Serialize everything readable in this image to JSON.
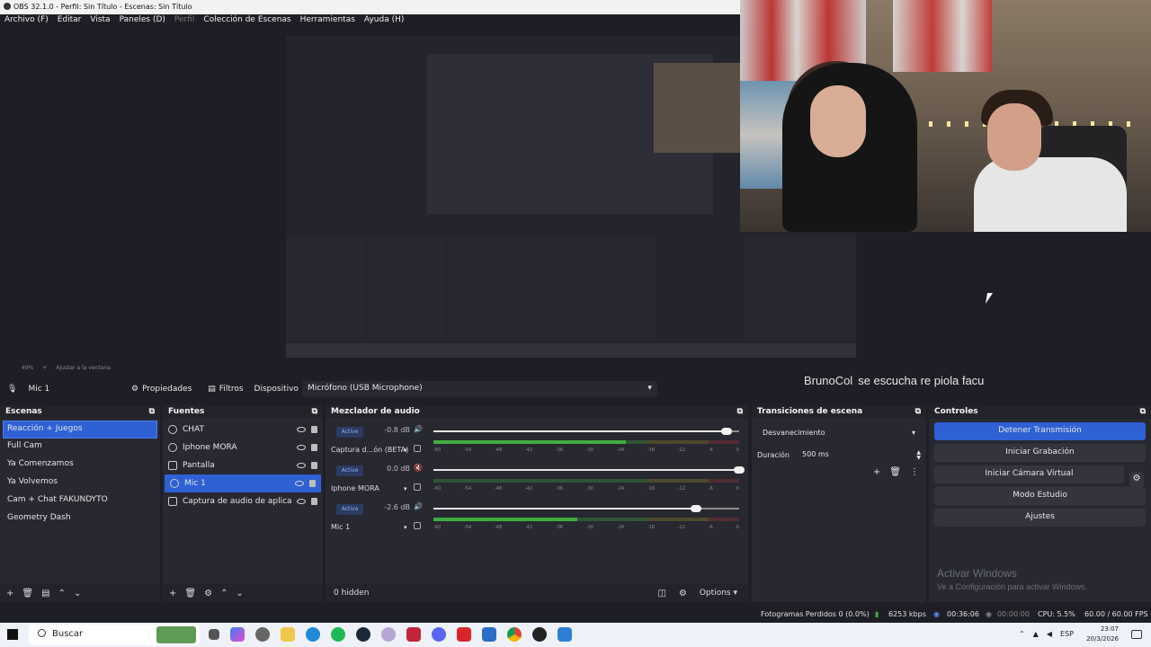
{
  "window": {
    "title": "OBS 32.1.0 - Perfil: Sin Título - Escenas: Sin Título"
  },
  "menu": [
    "Archivo (F)",
    "Editar",
    "Vista",
    "Paneles (D)",
    "Perfil",
    "Colección de Escenas",
    "Herramientas",
    "Ayuda (H)"
  ],
  "overlay": {
    "chat_user": "BrunoCol",
    "chat_message": "se escucha re piola facu"
  },
  "preview": {
    "zoom": "49%",
    "fit_label": "Ajustar a la ventana"
  },
  "context": {
    "source_name": "Mic 1",
    "properties_label": "Propiedades",
    "filters_label": "Filtros",
    "device_label": "Dispositivo",
    "device_value": "Micrófono (USB Microphone)"
  },
  "scenes": {
    "title": "Escenas",
    "items": [
      "Reacción + Juegos",
      "Full Cam",
      "Ya Comenzamos",
      "Ya Volvemos",
      "Cam + Chat FAKUNDYTO",
      "Geometry Dash"
    ],
    "selected": 0
  },
  "sources": {
    "title": "Fuentes",
    "items": [
      {
        "label": "CHAT",
        "icon": "globe-icon"
      },
      {
        "label": "Iphone MORA",
        "icon": "camera-icon"
      },
      {
        "label": "Pantalla",
        "icon": "monitor-icon"
      },
      {
        "label": "Mic 1",
        "icon": "microphone-icon"
      },
      {
        "label": "Captura de audio de aplicació",
        "icon": "app-audio-icon"
      }
    ],
    "selected": 3
  },
  "mixer": {
    "title": "Mezclador de audio",
    "ticks": [
      "-60",
      "-54",
      "-48",
      "-42",
      "-36",
      "-30",
      "-24",
      "-18",
      "-12",
      "-6",
      "0"
    ],
    "channels": [
      {
        "name": "Captura d...ón (BETA)",
        "badge": "Active",
        "db": "-0.8 dB",
        "level": 0.96,
        "meter": 0.63,
        "muted": false
      },
      {
        "name": "Iphone MORA",
        "badge": "Active",
        "db": "0.0 dB",
        "level": 1.0,
        "meter": 0.0,
        "muted": true
      },
      {
        "name": "Mic 1",
        "badge": "Active",
        "db": "-2.6 dB",
        "level": 0.86,
        "meter": 0.47,
        "muted": false
      }
    ],
    "hidden_label": "0 hidden",
    "options_label": "Options"
  },
  "transitions": {
    "title": "Transiciones de escena",
    "selected": "Desvanecimiento",
    "duration_label": "Duración",
    "duration_value": "500 ms"
  },
  "controls": {
    "title": "Controles",
    "stop_stream": "Detener Transmisión",
    "start_record": "Iniciar Grabación",
    "virtual_cam": "Iniciar Cámara Virtual",
    "studio_mode": "Modo Estudio",
    "settings": "Ajustes"
  },
  "watermark": {
    "line1": "Activar Windows",
    "line2": "Ve a Configuración para activar Windows."
  },
  "status": {
    "dropped": "Fotogramas Perdidos 0 (0.0%)",
    "bitrate": "6253 kbps",
    "stream_time": "00:36:06",
    "rec_time": "00:00:00",
    "cpu": "CPU: 5.5%",
    "fps": "60.00 / 60.00 FPS"
  },
  "taskbar": {
    "search_placeholder": "Buscar",
    "lang": "ESP",
    "time": "23:07",
    "date": "20/3/2026"
  },
  "colors": {
    "accent": "#2e61d4",
    "meter_green": "#3fae3f",
    "meter_yellow": "#9a8f22",
    "meter_red": "#a83535"
  }
}
